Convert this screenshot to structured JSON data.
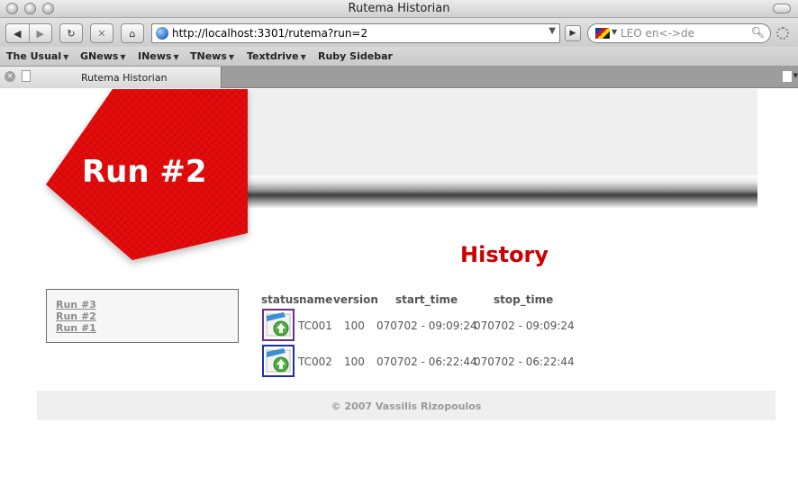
{
  "window": {
    "title": "Rutema Historian"
  },
  "toolbar": {
    "url": "http://localhost:3301/rutema?run=2",
    "search_placeholder": "LEO en<->de"
  },
  "bookmarks": [
    {
      "label": "The Usual",
      "has_menu": true
    },
    {
      "label": "GNews",
      "has_menu": true
    },
    {
      "label": "INews",
      "has_menu": true
    },
    {
      "label": "TNews",
      "has_menu": true
    },
    {
      "label": "Textdrive",
      "has_menu": true
    },
    {
      "label": "Ruby Sidebar",
      "has_menu": false
    }
  ],
  "tab": {
    "label": "Rutema Historian"
  },
  "page": {
    "run_title": "Run #2",
    "section_title": "History",
    "sidebar": {
      "runs": [
        "Run #3",
        "Run #2",
        "Run #1"
      ]
    },
    "table": {
      "headers": [
        "status",
        "name",
        "version",
        "start_time",
        "stop_time"
      ],
      "rows": [
        {
          "name": "TC001",
          "version": "100",
          "start_time": "070702 - 09:09:24",
          "stop_time": "070702 - 09:09:24"
        },
        {
          "name": "TC002",
          "version": "100",
          "start_time": "070702 - 06:22:44",
          "stop_time": "070702 - 06:22:44"
        }
      ]
    },
    "footer": "© 2007 Vassilis Rizopoulos"
  },
  "colors": {
    "accent_red": "#cc0000",
    "header_red": "#e60000"
  },
  "icons": [
    "back-icon",
    "forward-icon",
    "reload-icon",
    "stop-icon",
    "home-icon",
    "globe-icon",
    "search-icon",
    "flag-icon",
    "status-ok-icon"
  ]
}
